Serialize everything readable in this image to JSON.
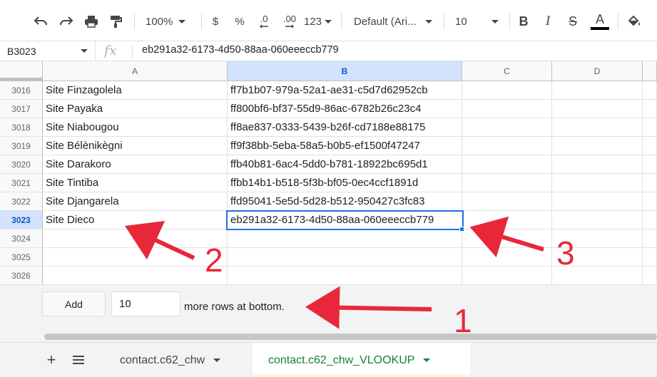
{
  "toolbar": {
    "zoom": "100%",
    "currency": "$",
    "percent": "%",
    "decrease_decimals": ".0",
    "increase_decimals": ".00",
    "more_formats": "123",
    "font_family": "Default (Ari...",
    "font_size": "10",
    "bold": "B",
    "italic": "I",
    "strikethrough": "S",
    "text_color": "A",
    "text_color_hex": "#000000"
  },
  "formula_bar": {
    "name_box": "B3023",
    "fx": "fx",
    "value": "eb291a32-6173-4d50-88aa-060eeeccb779"
  },
  "columns": [
    "A",
    "B",
    "C",
    "D"
  ],
  "selected": {
    "column": "B",
    "row": "3023"
  },
  "rows": [
    {
      "num": "3016",
      "a": "Site Finzagolela",
      "b": "ff7b1b07-979a-52a1-ae31-c5d7d62952cb"
    },
    {
      "num": "3017",
      "a": "Site Payaka",
      "b": "ff800bf6-bf37-55d9-86ac-6782b26c23c4"
    },
    {
      "num": "3018",
      "a": "Site Niabougou",
      "b": "ff8ae837-0333-5439-b26f-cd7188e88175"
    },
    {
      "num": "3019",
      "a": "Site Bélènikègni",
      "b": "ff9f38bb-5eba-58a5-b0b5-ef1500f47247"
    },
    {
      "num": "3020",
      "a": "Site Darakoro",
      "b": "ffb40b81-6ac4-5dd0-b781-18922bc695d1"
    },
    {
      "num": "3021",
      "a": "Site Tintiba",
      "b": "ffbb14b1-b518-5f3b-bf05-0ec4ccf1891d"
    },
    {
      "num": "3022",
      "a": "Site Djangarela",
      "b": "ffd95041-5e5d-5d28-b512-950427c3fc83"
    },
    {
      "num": "3023",
      "a": "Site Dieco",
      "b": "eb291a32-6173-4d50-88aa-060eeeccb779"
    },
    {
      "num": "3024",
      "a": "",
      "b": ""
    },
    {
      "num": "3025",
      "a": "",
      "b": ""
    },
    {
      "num": "3026",
      "a": "",
      "b": ""
    }
  ],
  "add_rows": {
    "button_label": "Add",
    "count": "10",
    "suffix": "more rows at bottom."
  },
  "sheet_tabs": [
    {
      "label": "contact.c62_chw",
      "active": false
    },
    {
      "label": "contact.c62_chw_VLOOKUP",
      "active": true
    }
  ],
  "annotations": {
    "color": "#e8283a",
    "labels": [
      "1",
      "2",
      "3"
    ]
  },
  "colors": {
    "selection": "#1a73e8",
    "active_tab_text": "#188038",
    "header_bg": "#f8f9fa"
  }
}
